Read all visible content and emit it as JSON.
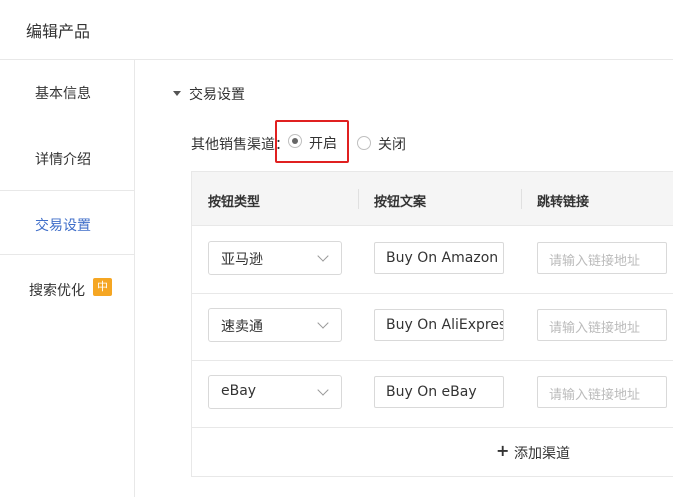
{
  "header": {
    "title": "编辑产品"
  },
  "sidebar": {
    "items": [
      {
        "label": "基本信息"
      },
      {
        "label": "详情介绍"
      },
      {
        "label": "交易设置"
      },
      {
        "label": "搜索优化",
        "badge": "中"
      }
    ],
    "active_index": 2,
    "active_color": "#3f6ec9",
    "badge_color": "#f5a623"
  },
  "section": {
    "title": "交易设置"
  },
  "other_channels": {
    "label": "其他销售渠道：",
    "options": [
      {
        "label": "开启",
        "checked": true
      },
      {
        "label": "关闭",
        "checked": false
      }
    ],
    "highlight_color": "#e02020"
  },
  "table": {
    "headers": [
      "按钮类型",
      "按钮文案",
      "跳转链接"
    ],
    "rows": [
      {
        "type": "亚马逊",
        "text": "Buy On Amazon",
        "link_placeholder": "请输入链接地址"
      },
      {
        "type": "速卖通",
        "text": "Buy On AliExpres",
        "link_placeholder": "请输入链接地址"
      },
      {
        "type": "eBay",
        "text": "Buy On eBay",
        "link_placeholder": "请输入链接地址"
      }
    ],
    "add_label": "添加渠道"
  }
}
